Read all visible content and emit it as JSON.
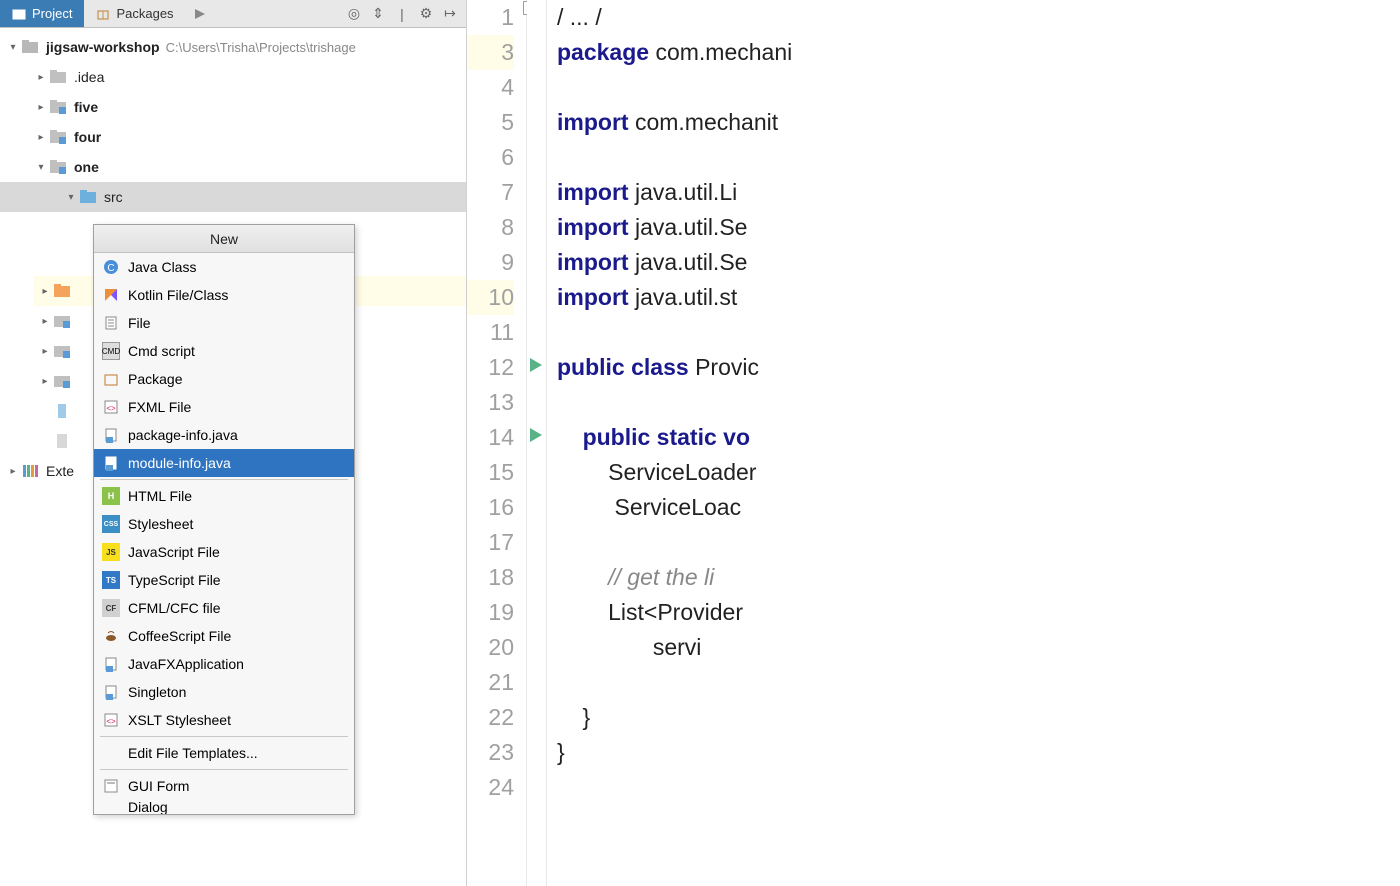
{
  "tabs": {
    "project": "Project",
    "packages": "Packages"
  },
  "project": {
    "root": "jigsaw-workshop",
    "root_path": "C:\\Users\\Trisha\\Projects\\trishage",
    "idea": ".idea",
    "five": "five",
    "four": "four",
    "one": "one",
    "src": "src",
    "external": "Exte"
  },
  "ctx": {
    "header": "New",
    "items": {
      "java_class": "Java Class",
      "kotlin": "Kotlin File/Class",
      "file": "File",
      "cmd": "Cmd script",
      "package": "Package",
      "fxml": "FXML File",
      "pkginfo": "package-info.java",
      "modinfo": "module-info.java",
      "html": "HTML File",
      "css": "Stylesheet",
      "js": "JavaScript File",
      "ts": "TypeScript File",
      "cfml": "CFML/CFC file",
      "coffee": "CoffeeScript File",
      "jfx": "JavaFXApplication",
      "singleton": "Singleton",
      "xslt": "XSLT Stylesheet",
      "edit_tpl": "Edit File Templates...",
      "gui": "GUI Form",
      "dialog": "Dialog"
    }
  },
  "code": {
    "l1": "/ ... /",
    "l3a": "package",
    "l3b": " com.mechani",
    "l5a": "import",
    "l5b": " com.mechanit",
    "l7a": "import",
    "l7b": " java.util.Li",
    "l8a": "import",
    "l8b": " java.util.Se",
    "l9a": "import",
    "l9b": " java.util.Se",
    "l10a": "import",
    "l10b": " java.util.st",
    "l12a": "public",
    "l12b": " class",
    "l12c": " Provic",
    "l14a": "public",
    "l14b": " static",
    "l14c": " vo",
    "l15": "        ServiceLoader",
    "l16": "         ServiceLoac",
    "l18": "        // get the li",
    "l19": "        List<Provider",
    "l20": "               servi",
    "l22": "    }",
    "l23": "}"
  },
  "line_numbers": [
    "1",
    "3",
    "4",
    "5",
    "6",
    "7",
    "8",
    "9",
    "10",
    "11",
    "12",
    "13",
    "14",
    "15",
    "16",
    "17",
    "18",
    "19",
    "20",
    "21",
    "22",
    "23",
    "24"
  ]
}
